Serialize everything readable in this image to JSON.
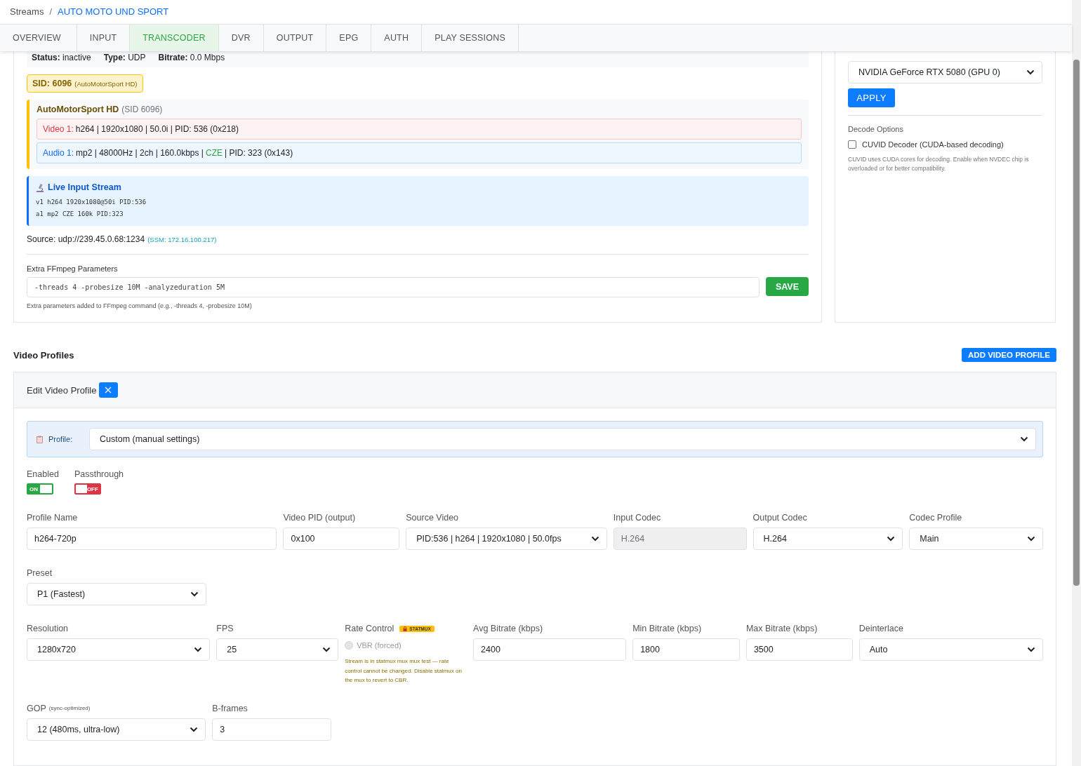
{
  "breadcrumb": {
    "root": "Streams",
    "separator": "/",
    "current": "AUTO MOTO UND SPORT"
  },
  "tabs": [
    {
      "label": "OVERVIEW",
      "selected": false
    },
    {
      "label": "INPUT",
      "selected": false
    },
    {
      "label": "TRANSCODER",
      "selected": true
    },
    {
      "label": "DVR",
      "selected": false
    },
    {
      "label": "OUTPUT",
      "selected": false
    },
    {
      "label": "EPG",
      "selected": false
    },
    {
      "label": "AUTH",
      "selected": false
    },
    {
      "label": "PLAY SESSIONS",
      "selected": false
    }
  ],
  "status": [
    "**Status:** inactive",
    "**Type:** UDP",
    "**Bitrate:** 0.0 Mbps"
  ],
  "sid_badge": {
    "label": "SID: 6096",
    "note": "(AutoMotorSport HD)"
  },
  "program": {
    "name": "AutoMotorSport HD",
    "sid": "(SID 6096)",
    "streams": [
      {
        "kind": "video",
        "label": "Video 1:",
        "text": "h264 | 1920x1080 | 50.0i | PID: 536 (0x218)"
      },
      {
        "kind": "audio",
        "label": "Audio 1:",
        "text": "mp2 | 48000Hz | 2ch | 160.0kbps |",
        "language": "CZE",
        "rest": "| PID: 323 (0x143)"
      }
    ]
  },
  "live_input": {
    "title": "Live Input Stream",
    "lines": [
      "v1 h264 1920x1080@50i PID:536",
      "a1 mp2 CZE 160k PID:323"
    ]
  },
  "source": {
    "text": "Source: udp://239.45.0.68:1234",
    "ssm": "(SSM: 172.16.100.217)"
  },
  "ffmpeg": {
    "label": "Extra FFmpeg Parameters",
    "value": "-threads 4 -probesize 10M -analyzeduration 5M",
    "button": "SAVE",
    "help": "Extra parameters added to FFmpeg command (e.g., -threads 4, -probesize 10M)"
  },
  "gpu": {
    "device": "NVIDIA GeForce RTX 5080 (GPU 0)",
    "button": "APPLY",
    "decode_title": "Decode Options",
    "cuvid": {
      "label": "CUVID Decoder (CUDA-based decoding)",
      "checked": false
    },
    "help": "CUVID uses CUDA cores for decoding. Enable when NVDEC chip is overloaded or for better compatibility."
  },
  "video_profiles": {
    "title": "Video Profiles",
    "add_button": "ADD VIDEO PROFILE"
  },
  "editor": {
    "title": "Edit Video Profile",
    "profile": {
      "label": "Profile:",
      "value": "Custom (manual settings)"
    },
    "toggles": [
      {
        "label": "Enabled",
        "on": true,
        "text": "ON"
      },
      {
        "label": "Passthrough",
        "on": false,
        "text": "OFF"
      }
    ],
    "fields": [
      {
        "kind": "text",
        "label": "Profile Name",
        "value": "h264-720p"
      },
      {
        "kind": "text",
        "label": "Video PID (output)",
        "value": "0x100"
      },
      {
        "kind": "select",
        "label": "Source Video",
        "value": "PID:536 | h264 | 1920x1080 | 50.0fps"
      },
      {
        "kind": "readonly",
        "label": "Input Codec",
        "value": "H.264"
      },
      {
        "kind": "select",
        "label": "Output Codec",
        "value": "H.264"
      },
      {
        "kind": "select",
        "label": "Codec Profile",
        "value": "Main"
      },
      {
        "kind": "select",
        "label": "Preset",
        "value": "P1 (Fastest)"
      },
      {
        "kind": "select",
        "label": "Resolution",
        "value": "1280x720"
      },
      {
        "kind": "select",
        "label": "FPS",
        "value": "25"
      },
      {
        "kind": "rate",
        "label": "Rate Control",
        "badge": "STATMUX",
        "option": "VBR (forced)",
        "disabled": true,
        "note": "Stream is in statmux mux mux test — rate control cannot be changed. Disable statmux on the mux to revert to CBR."
      },
      {
        "kind": "text",
        "label": "Avg Bitrate (kbps)",
        "value": "2400"
      },
      {
        "kind": "text",
        "label": "Min Bitrate (kbps)",
        "value": "1800"
      },
      {
        "kind": "text",
        "label": "Max Bitrate (kbps)",
        "value": "3500"
      },
      {
        "kind": "select",
        "label": "Deinterlace",
        "value": "Auto"
      },
      {
        "kind": "select",
        "label": "GOP",
        "note": "(sync-optimized)",
        "value": "12 (480ms, ultra-low)"
      },
      {
        "kind": "text",
        "label": "B-frames",
        "value": "3"
      }
    ]
  }
}
